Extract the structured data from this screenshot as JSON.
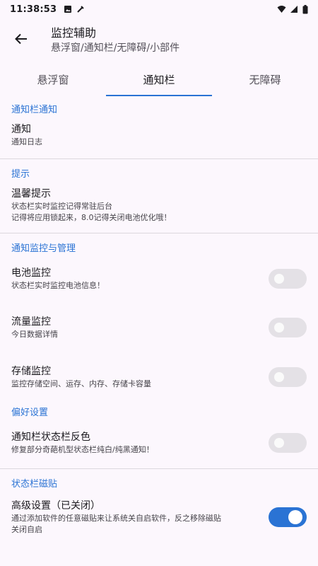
{
  "status_bar": {
    "time": "11:38:53"
  },
  "app_bar": {
    "title": "监控辅助",
    "subtitle": "悬浮窗/通知栏/无障碍/小部件"
  },
  "tabs": [
    {
      "label": "悬浮窗"
    },
    {
      "label": "通知栏"
    },
    {
      "label": "无障碍"
    }
  ],
  "sections": {
    "notification_bar": {
      "header": "通知栏通知",
      "items": [
        {
          "title": "通知",
          "subtitle": "通知日志"
        }
      ]
    },
    "tips": {
      "header": "提示",
      "items": [
        {
          "title": "温馨提示",
          "subtitle": "状态栏实时监控记得常驻后台",
          "subtitle2": "记得将应用锁起来，8.0记得关闭电池优化哦！"
        }
      ]
    },
    "monitor": {
      "header": "通知监控与管理",
      "items": [
        {
          "title": "电池监控",
          "subtitle": "状态栏实时监控电池信息！",
          "enabled": false
        },
        {
          "title": "流量监控",
          "subtitle": "今日数据详情",
          "enabled": false
        },
        {
          "title": "存储监控",
          "subtitle": "监控存储空间、运存、内存、存储卡容量",
          "enabled": false
        }
      ]
    },
    "preferences": {
      "header": "偏好设置",
      "items": [
        {
          "title": "通知栏状态栏反色",
          "subtitle": "修复部分奇葩机型状态栏纯白/纯黑通知！",
          "enabled": false
        }
      ]
    },
    "tiles": {
      "header": "状态栏磁贴",
      "items": [
        {
          "title": "高级设置（已关闭）",
          "subtitle": "通过添加软件的任意磁贴来让系统关自启软件，反之移除磁贴",
          "subtitle2": "关闭自启",
          "enabled": true
        }
      ]
    }
  },
  "colors": {
    "accent": "#2a73d4",
    "background": "#fcf7fd",
    "divider": "#dcd8de"
  }
}
